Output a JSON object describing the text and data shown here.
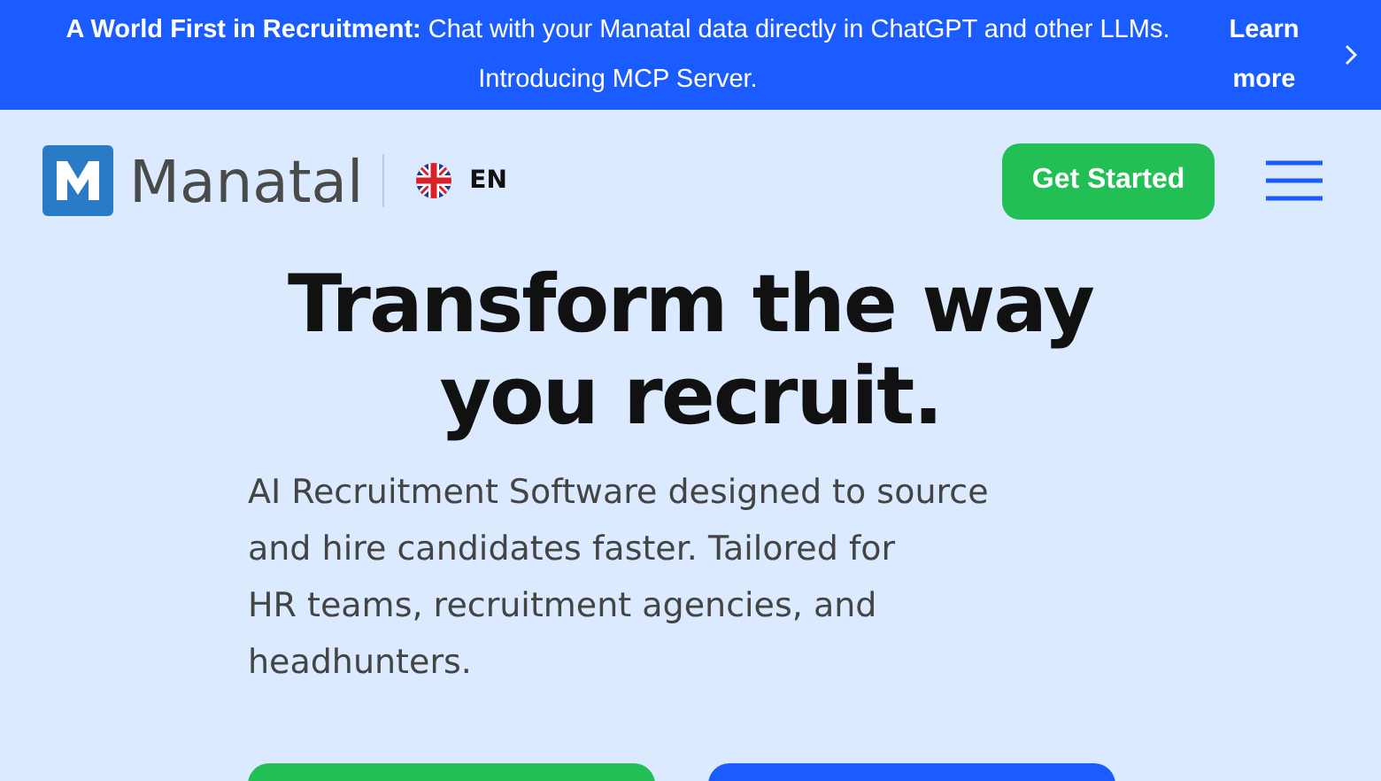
{
  "announcement": {
    "text": "**A World First in Recruitment:** Chat with your Manatal data directly in ChatGPT and other LLMs. Introducing MCP Server.",
    "link": "Learn more"
  },
  "header": {
    "logo": "Manatal",
    "language": "EN",
    "cta": "Get Started"
  },
  "hero": {
    "headline_lines": [
      "Transform the way",
      "you recruit."
    ],
    "subtitle_lines": [
      "AI Recruitment Software designed to source",
      "and hire candidates faster. Tailored for",
      "HR teams, recruitment agencies, and",
      "headhunters."
    ]
  }
}
